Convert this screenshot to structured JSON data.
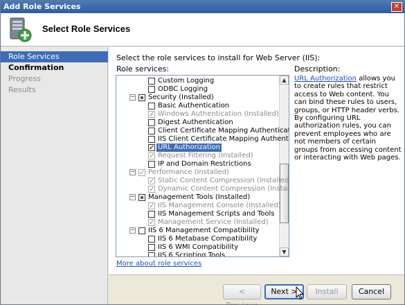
{
  "window": {
    "title": "Add Role Services",
    "close_icon": "close-icon"
  },
  "header": {
    "title": "Select Role Services",
    "icon": "server-role-icon"
  },
  "nav": {
    "items": [
      {
        "label": "Role Services",
        "state": "active"
      },
      {
        "label": "Confirmation",
        "state": "bold"
      },
      {
        "label": "Progress",
        "state": "dim"
      },
      {
        "label": "Results",
        "state": "normal"
      }
    ]
  },
  "content": {
    "instruction": "Select the role services to install for Web Server (IIS):",
    "services_label": "Role services:",
    "tree": [
      {
        "label": "Custom Logging",
        "checked": false,
        "dim": false
      },
      {
        "label": "ODBC Logging",
        "checked": false,
        "dim": false
      },
      {
        "label": "Security  (Installed)",
        "checked": "partial",
        "dim": false,
        "expander": "⊟"
      },
      {
        "label": "Basic Authentication",
        "checked": false,
        "dim": false
      },
      {
        "label": "Windows Authentication  (Installed)",
        "checked": true,
        "dim": true
      },
      {
        "label": "Digest Authentication",
        "checked": false,
        "dim": false
      },
      {
        "label": "Client Certificate Mapping Authentication",
        "checked": false,
        "dim": false
      },
      {
        "label": "IIS Client Certificate Mapping Authentication",
        "checked": false,
        "dim": false
      },
      {
        "label": "URL Authorization",
        "checked": true,
        "dim": false,
        "selected": true
      },
      {
        "label": "Request Filtering  (Installed)",
        "checked": true,
        "dim": true
      },
      {
        "label": "IP and Domain Restrictions",
        "checked": false,
        "dim": false
      },
      {
        "label": "Performance  (Installed)",
        "checked": true,
        "dim": true,
        "expander": "⊟"
      },
      {
        "label": "Static Content Compression  (Installed)",
        "checked": true,
        "dim": true
      },
      {
        "label": "Dynamic Content Compression  (Installed)",
        "checked": true,
        "dim": true
      },
      {
        "label": "Management Tools  (Installed)",
        "checked": "partial",
        "dim": false,
        "expander": "⊟"
      },
      {
        "label": "IIS Management Console  (Installed)",
        "checked": true,
        "dim": true
      },
      {
        "label": "IIS Management Scripts and Tools",
        "checked": false,
        "dim": false
      },
      {
        "label": "Management Service  (Installed)",
        "checked": true,
        "dim": true
      },
      {
        "label": "IIS 6 Management Compatibility",
        "checked": false,
        "dim": false,
        "expander": "⊟"
      },
      {
        "label": "IIS 6 Metabase Compatibility",
        "checked": false,
        "dim": false
      },
      {
        "label": "IIS 6 WMI Compatibility",
        "checked": false,
        "dim": false
      },
      {
        "label": "IIS 6 Scripting Tools",
        "checked": false,
        "dim": false
      }
    ],
    "description": {
      "title": "Description:",
      "link": "URL Authorization",
      "text": "allows you to create rules that restrict access to Web content. You can bind these rules to users, groups, or HTTP header verbs. By configuring URL authorization rules, you can prevent employees who are not members of certain groups from accessing content or interacting with Web pages."
    },
    "more_link": "More about role services"
  },
  "footer": {
    "previous": "< Previous",
    "next": "Next >",
    "install": "Install",
    "cancel": "Cancel"
  }
}
